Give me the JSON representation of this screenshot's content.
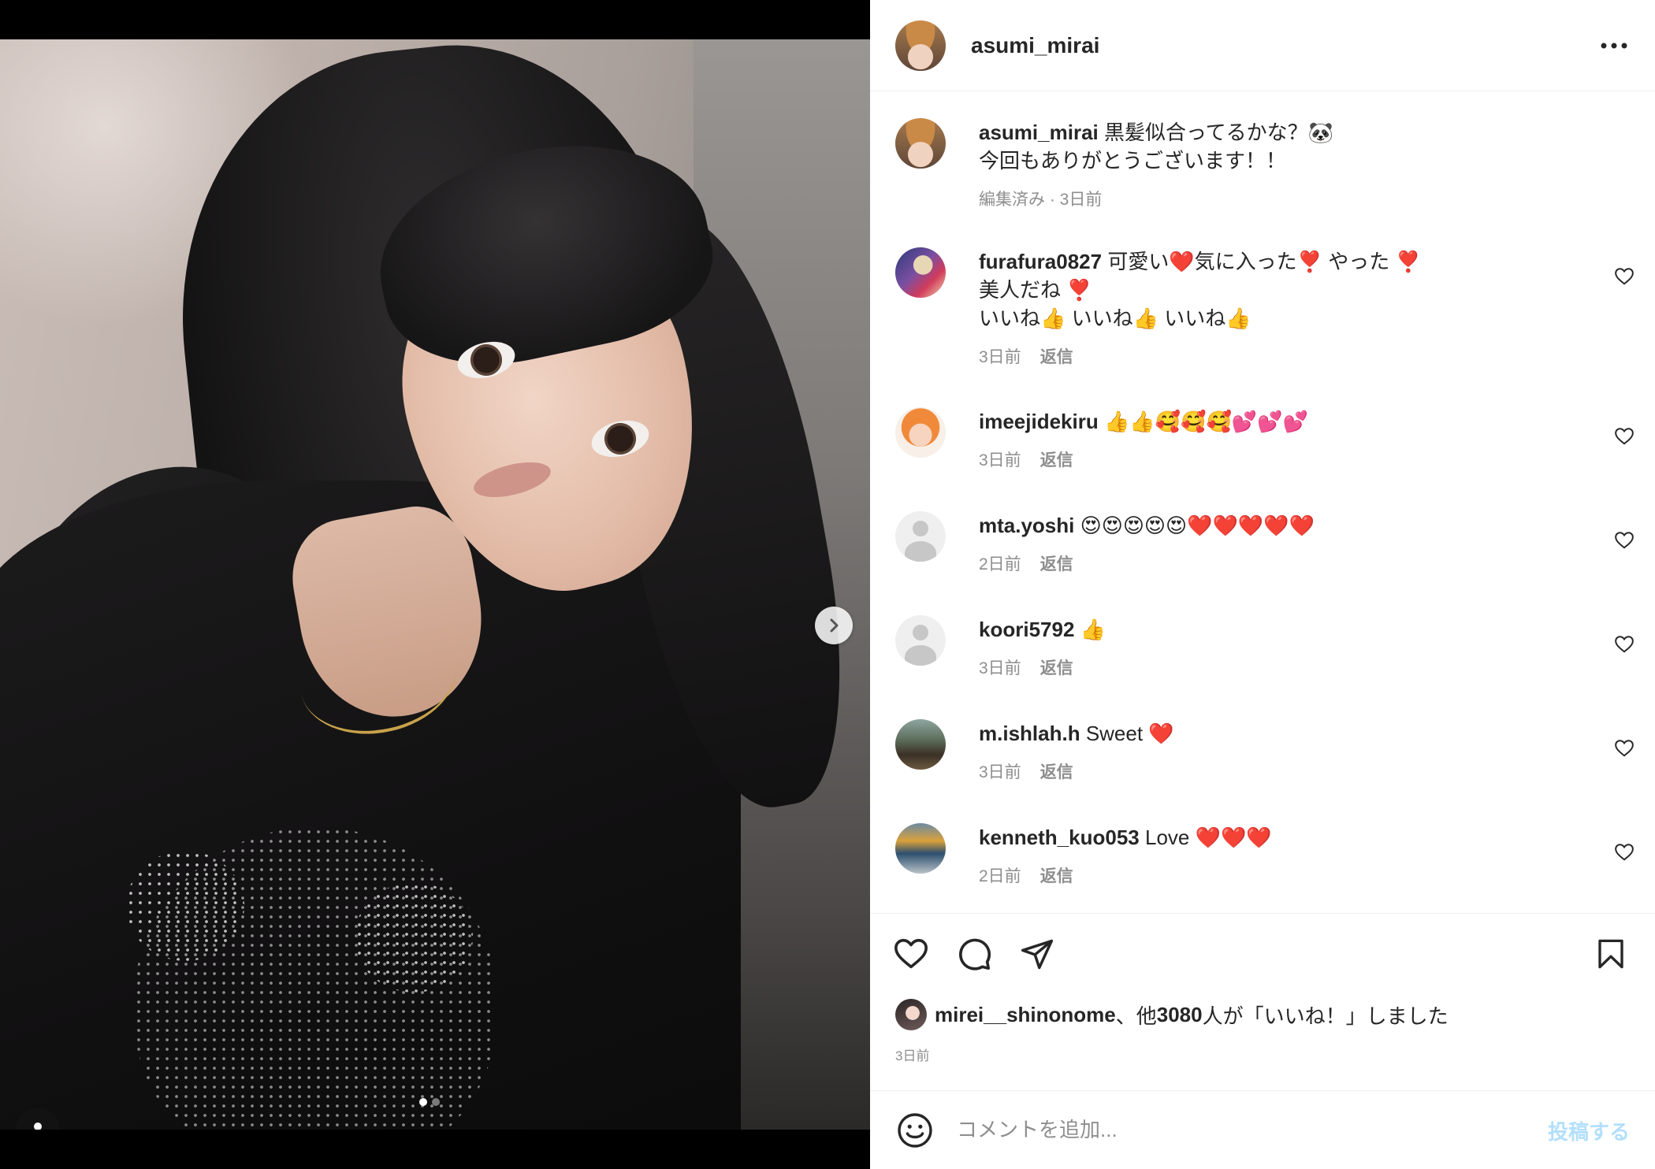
{
  "post": {
    "owner": "asumi_mirai",
    "caption_line1": "黒髪似合ってるかな？🐼",
    "caption_line2": "今回もありがとうございます！！",
    "caption_meta": "編集済み · 3日前"
  },
  "carousel": {
    "current_index": 1,
    "total": 2
  },
  "comments": [
    {
      "username": "furafura0827",
      "lines": [
        "可愛い❤️気に入った❣️ やった ❣️",
        "美人だね ❣️",
        "いいね👍 いいね👍 いいね👍"
      ],
      "time": "3日前",
      "reply": "返信",
      "avatar": "furafura-avatar"
    },
    {
      "username": "imeejidekiru",
      "lines": [
        "👍👍🥰🥰🥰💕💕💕"
      ],
      "time": "3日前",
      "reply": "返信",
      "avatar": "imeejidekiru-avatar"
    },
    {
      "username": "mta.yoshi",
      "lines": [
        "😍😍😍😍😍❤️❤️❤️❤️❤️"
      ],
      "time": "2日前",
      "reply": "返信",
      "avatar": "default-avatar"
    },
    {
      "username": "koori5792",
      "lines": [
        "👍"
      ],
      "time": "3日前",
      "reply": "返信",
      "avatar": "default-avatar"
    },
    {
      "username": "m.ishlah.h",
      "lines": [
        "Sweet ❤️"
      ],
      "time": "3日前",
      "reply": "返信",
      "avatar": "ishlah-avatar"
    },
    {
      "username": "kenneth_kuo053",
      "lines": [
        "Love ❤️❤️❤️"
      ],
      "time": "2日前",
      "reply": "返信",
      "avatar": "kenneth-avatar"
    }
  ],
  "likes": {
    "first_liker": "mirei__shinonome",
    "text_mid": "、他",
    "count": "3080",
    "text_end": " 人が「いいね！」しました",
    "date": "3日前"
  },
  "compose": {
    "placeholder": "コメントを追加...",
    "post_label": "投稿する"
  },
  "icons": {
    "more": "more-horizontal-icon",
    "like": "heart-icon",
    "comment": "comment-bubble-icon",
    "share": "paper-plane-icon",
    "save": "bookmark-icon",
    "emoji": "smiley-icon",
    "next": "chevron-right-icon",
    "user_tag": "user-tag-icon"
  },
  "colors": {
    "text": "#262626",
    "secondary": "#8e8e8e",
    "divider": "#efefef",
    "post_disabled": "#b2dffc"
  }
}
